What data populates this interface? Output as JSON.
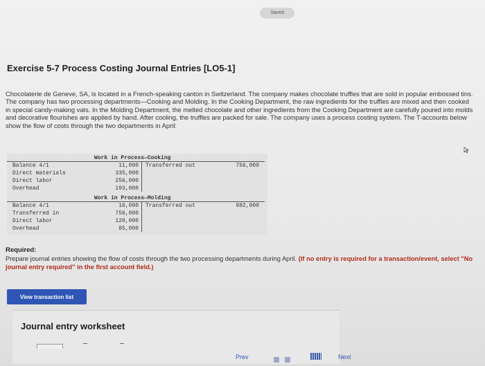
{
  "status": {
    "saved": "Saved"
  },
  "exercise": {
    "title": "Exercise 5-7 Process Costing Journal Entries [LO5-1]"
  },
  "problem_text": "Chocolaterie de Geneve, SA, is located in a French-speaking canton in Switzerland. The company makes chocolate truffles that are sold in popular embossed tins. The company has two processing departments—Cooking and Molding. In the Cooking Department, the raw ingredients for the truffles are mixed and then cooked in special candy-making vats. In the Molding Department, the melted chocolate and other ingredients from the Cooking Department are carefully poured into molds and decorative flourishes are applied by hand. After cooling, the truffles are packed for sale. The company uses a process costing system. The T-accounts below show the flow of costs through the two departments in April:",
  "t_accounts": {
    "cooking": {
      "title": "Work in Process—Cooking",
      "debits": [
        {
          "label": "Balance 4/1",
          "value": "11,000"
        },
        {
          "label": "Direct materials",
          "value": "335,000"
        },
        {
          "label": "Direct labor",
          "value": "256,000"
        },
        {
          "label": "Overhead",
          "value": "193,000"
        }
      ],
      "credit_label": "Transferred out",
      "credit_value": "756,000"
    },
    "molding": {
      "title": "Work in Process—Molding",
      "debits": [
        {
          "label": "Balance 4/1",
          "value": "16,000"
        },
        {
          "label": "Transferred in",
          "value": "756,000"
        },
        {
          "label": "Direct labor",
          "value": "120,000"
        },
        {
          "label": "Overhead",
          "value": "85,000"
        }
      ],
      "credit_label": "Transferred out",
      "credit_value": "982,000"
    }
  },
  "required": {
    "heading": "Required:",
    "text": "Prepare journal entries showing the flow of costs through the two processing departments during April.",
    "note": "(If no entry is required for a transaction/event, select \"No journal entry required\" in the first account field.)"
  },
  "buttons": {
    "view_transactions": "View transaction list"
  },
  "worksheet": {
    "title": "Journal entry worksheet"
  },
  "nav": {
    "prev": "Prev",
    "next": "Next"
  }
}
